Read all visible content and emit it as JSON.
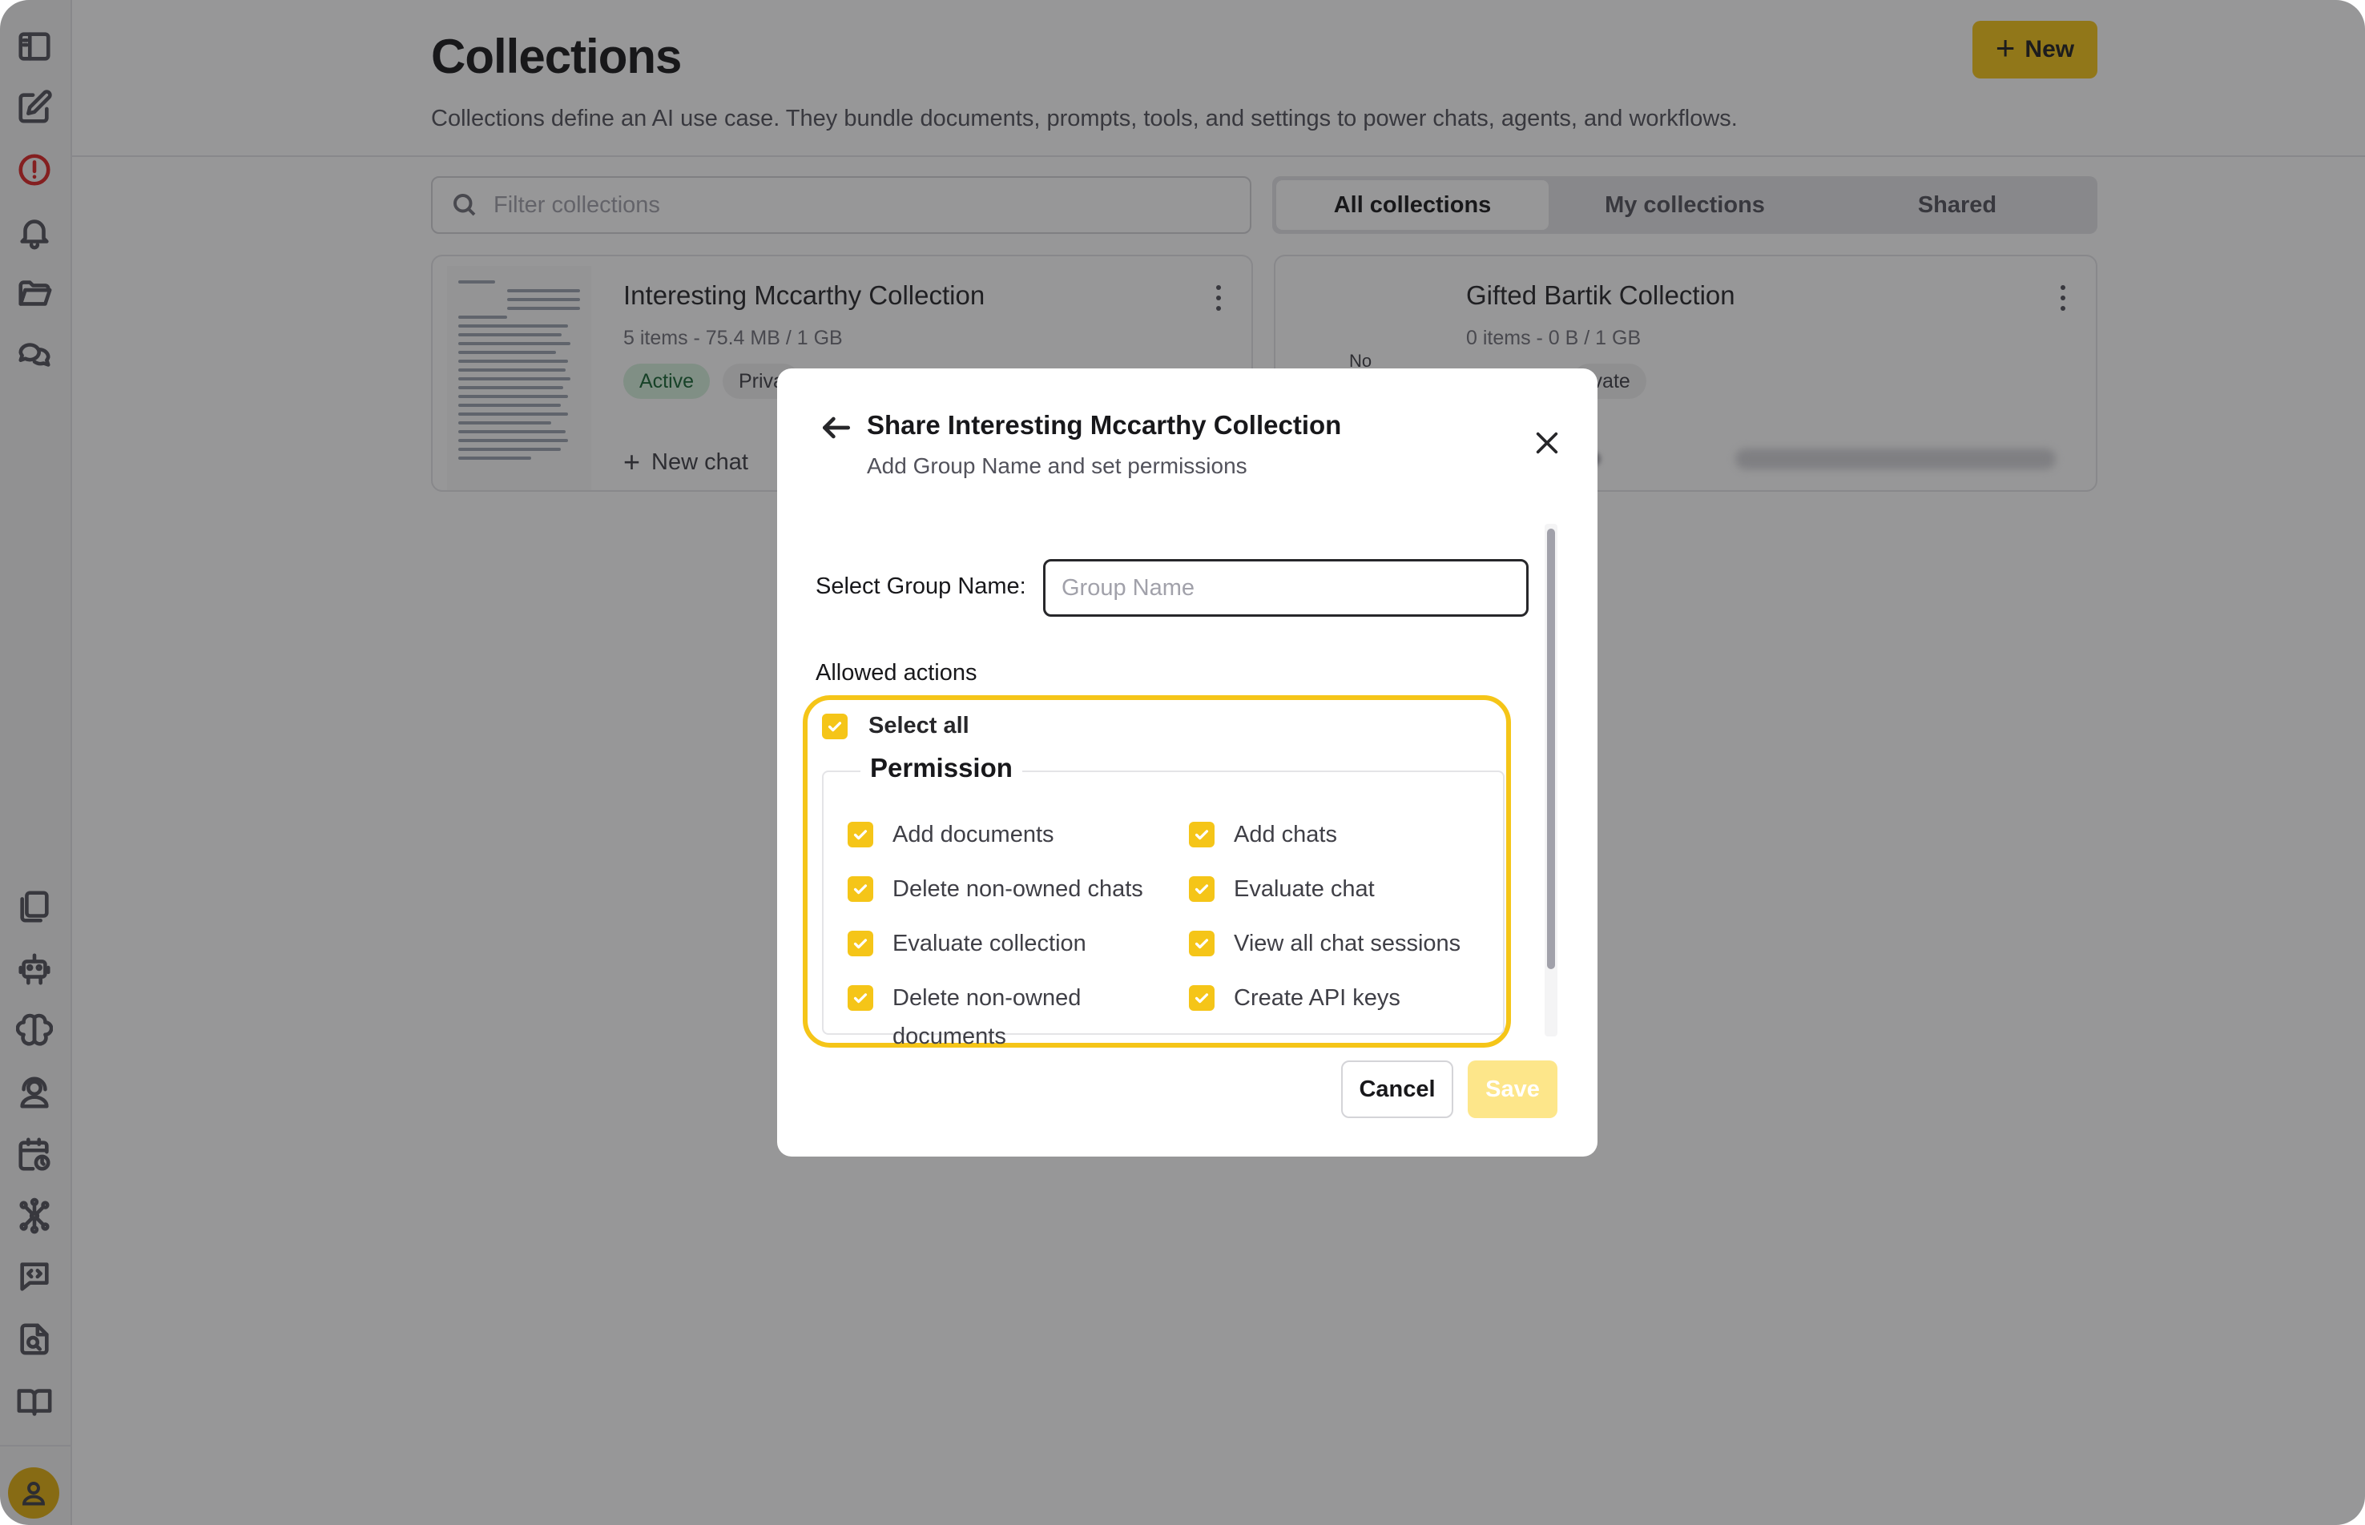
{
  "page": {
    "title": "Collections",
    "description": "Collections define an AI use case. They bundle documents, prompts, tools, and settings to power chats, agents, and workflows.",
    "new_button": "New",
    "filter_placeholder": "Filter collections",
    "tabs": [
      {
        "label": "All collections",
        "active": true
      },
      {
        "label": "My collections",
        "active": false
      },
      {
        "label": "Shared",
        "active": false
      }
    ]
  },
  "sidebar": {
    "icons": [
      "panel-toggle-icon",
      "edit-icon",
      "alert-icon",
      "bell-icon",
      "folder-icon",
      "chat-bubbles-icon",
      "documents-icon",
      "robot-icon",
      "brain-icon",
      "support-agent-icon",
      "calendar-clock-icon",
      "network-icon",
      "code-message-icon",
      "file-search-icon",
      "book-icon",
      "user-avatar-icon"
    ]
  },
  "collections": [
    {
      "title": "Interesting Mccarthy Collection",
      "meta": "5 items - 75.4 MB / 1 GB",
      "status": "Active",
      "visibility": "Priva",
      "new_chat": "New chat"
    },
    {
      "title": "Gifted Bartik Collection",
      "meta": "0 items - 0 B / 1 GB",
      "thumb_label": "No",
      "visibility": "ivate"
    }
  ],
  "modal": {
    "title": "Share Interesting Mccarthy Collection",
    "subtitle": "Add Group Name and set permissions",
    "group_label": "Select Group Name:",
    "group_placeholder": "Group Name",
    "allowed_actions": "Allowed actions",
    "select_all": "Select all",
    "permission_legend": "Permission",
    "permissions_col1": [
      "Add documents",
      "Delete non-owned chats",
      "Evaluate collection",
      "Delete non-owned documents"
    ],
    "permissions_col2": [
      "Add chats",
      "Evaluate chat",
      "View all chat sessions",
      "Create API keys"
    ],
    "cancel": "Cancel",
    "save": "Save"
  },
  "colors": {
    "accent": "#f5c518",
    "accent_disabled": "#fde68a",
    "active_tag_bg": "#d6f0dc",
    "active_tag_text": "#166534",
    "alert_icon": "#dc2626"
  }
}
